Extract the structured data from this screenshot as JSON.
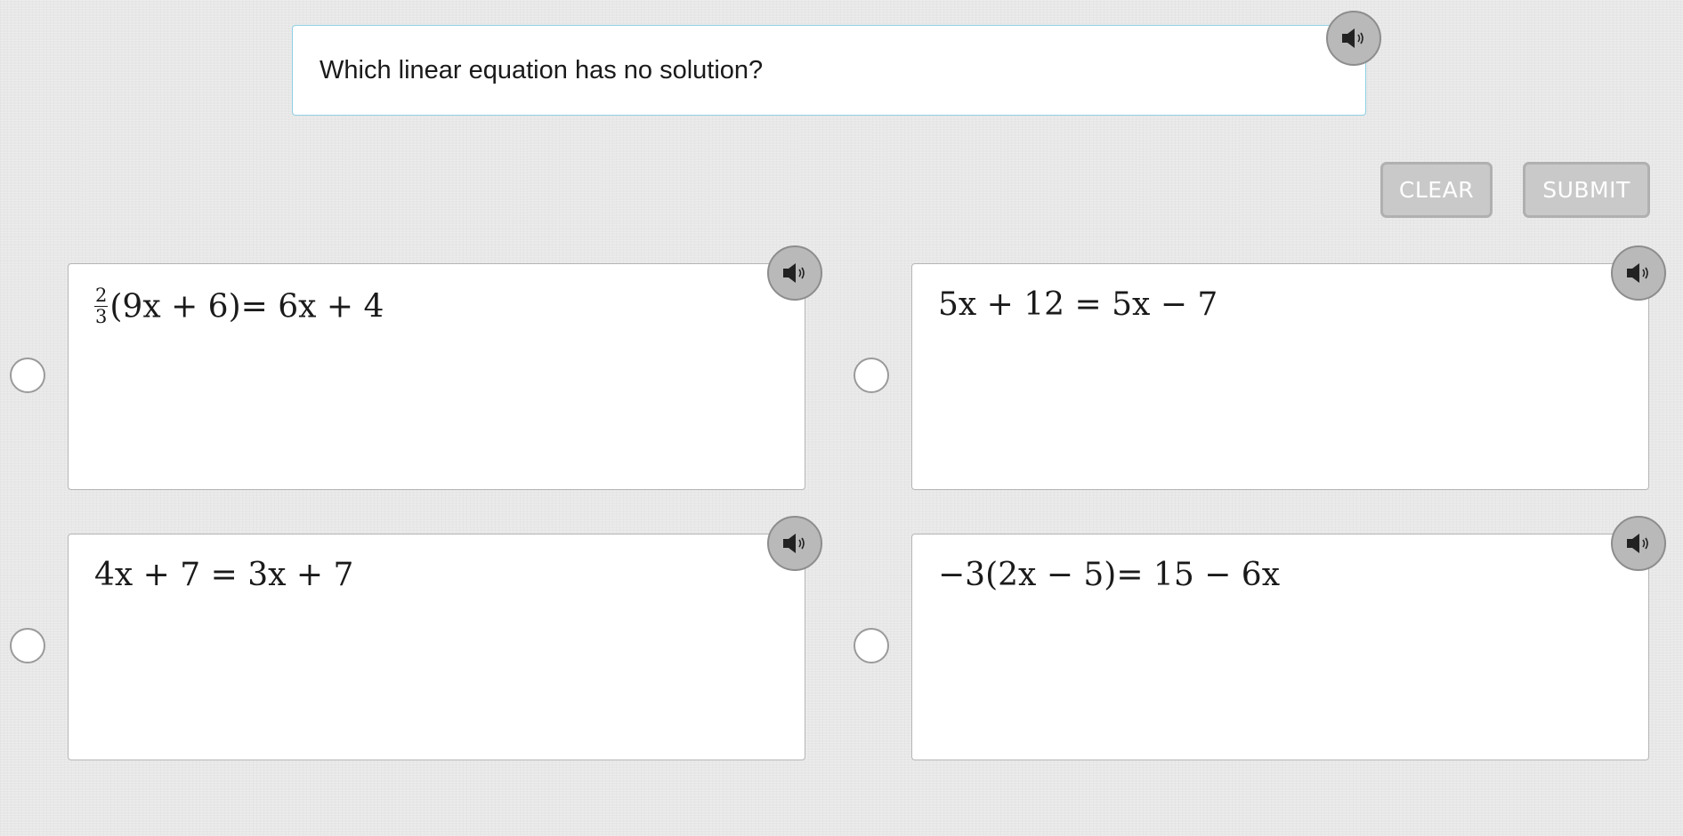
{
  "question": {
    "text": "Which linear equation has no solution?",
    "audio_icon": "speaker-icon"
  },
  "buttons": {
    "clear_label": "CLEAR",
    "submit_label": "SUBMIT"
  },
  "options": [
    {
      "fraction_numerator": "2",
      "fraction_denominator": "3",
      "equation": "(9x + 6)= 6x + 4",
      "selected": false,
      "audio_icon": "speaker-icon"
    },
    {
      "equation": "5x + 12 = 5x − 7",
      "selected": false,
      "audio_icon": "speaker-icon"
    },
    {
      "equation": "4x + 7 = 3x + 7",
      "selected": false,
      "audio_icon": "speaker-icon"
    },
    {
      "equation": "−3(2x − 5)= 15 − 6x",
      "selected": false,
      "audio_icon": "speaker-icon"
    }
  ],
  "colors": {
    "page_background": "#e8e8e8",
    "question_border": "#8fd0e4",
    "audio_button": "#b9b9b9",
    "disabled_button": "#c9c9c9"
  }
}
